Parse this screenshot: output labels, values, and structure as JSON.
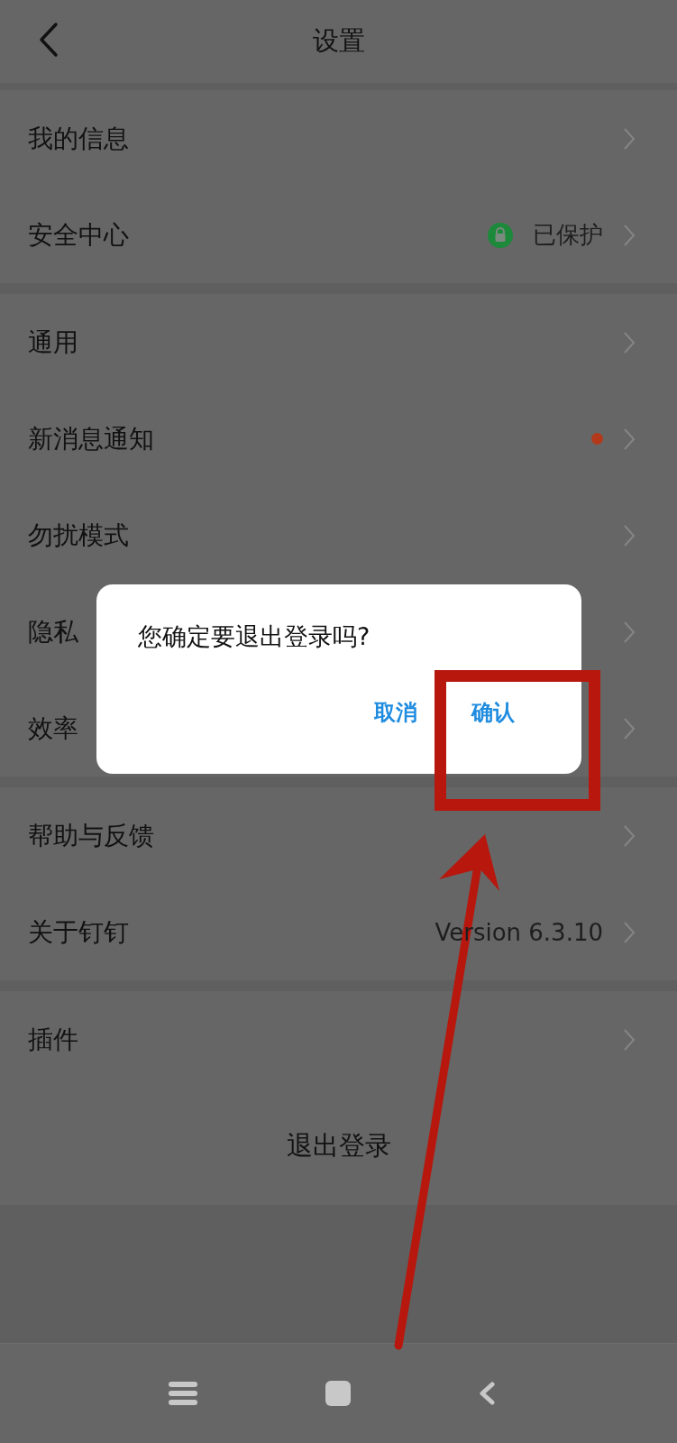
{
  "header": {
    "title": "设置"
  },
  "groups": [
    {
      "rows": [
        {
          "kind": "plain",
          "label": "我的信息"
        },
        {
          "kind": "status",
          "label": "安全中心",
          "value": "已保护"
        }
      ]
    },
    {
      "rows": [
        {
          "kind": "plain",
          "label": "通用"
        },
        {
          "kind": "dot",
          "label": "新消息通知",
          "color": "#b23a1a"
        },
        {
          "kind": "plain",
          "label": "勿扰模式"
        },
        {
          "kind": "plain",
          "label": "隐私"
        },
        {
          "kind": "plain",
          "label": "效率"
        }
      ]
    },
    {
      "rows": [
        {
          "kind": "plain",
          "label": "帮助与反馈"
        },
        {
          "kind": "value",
          "label": "关于钉钉",
          "value": "Version 6.3.10"
        }
      ]
    },
    {
      "rows": [
        {
          "kind": "plain",
          "label": "插件"
        }
      ]
    }
  ],
  "logout": "退出登录",
  "dialog": {
    "message": "您确定要退出登录吗?",
    "buttons": [
      {
        "label": "取消"
      },
      {
        "label": "确认"
      }
    ]
  }
}
